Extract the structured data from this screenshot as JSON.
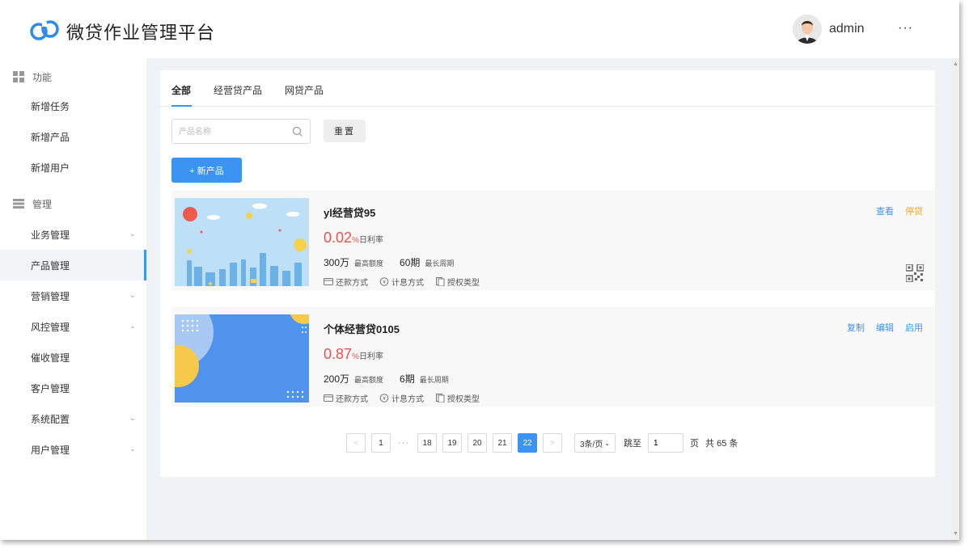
{
  "header": {
    "app_title": "微贷作业管理平台",
    "username": "admin",
    "more": "···"
  },
  "sidebar": {
    "groups": [
      {
        "label": "功能",
        "icon": "grid-icon"
      },
      {
        "label": "管理",
        "icon": "stack-icon"
      }
    ],
    "function_items": [
      "新增任务",
      "新增产品",
      "新增用户"
    ],
    "management_items": [
      {
        "label": "业务管理",
        "expandable": true
      },
      {
        "label": "产品管理",
        "expandable": false,
        "active": true
      },
      {
        "label": "营销管理",
        "expandable": true
      },
      {
        "label": "风控管理",
        "expandable": true
      },
      {
        "label": "催收管理",
        "expandable": false
      },
      {
        "label": "客户管理",
        "expandable": false
      },
      {
        "label": "系统配置",
        "expandable": true
      },
      {
        "label": "用户管理",
        "expandable": true
      }
    ]
  },
  "tabs": [
    {
      "label": "全部",
      "active": true
    },
    {
      "label": "经营贷产品",
      "active": false
    },
    {
      "label": "网贷产品",
      "active": false
    }
  ],
  "filters": {
    "search_placeholder": "产品名称",
    "search_value": "",
    "reset_label": "重置",
    "new_product_label": "+ 新产品"
  },
  "products": [
    {
      "name": "yl经营贷95",
      "rate": "0.02",
      "rate_unit": "%",
      "rate_label": "日利率",
      "amount": "300万",
      "amount_label": "最高额度",
      "period": "60期",
      "period_label": "最长周期",
      "tags": [
        "还款方式",
        "计息方式",
        "授权类型"
      ],
      "actions": [
        {
          "label": "查看",
          "style": "link"
        },
        {
          "label": "停贷",
          "style": "warn"
        }
      ],
      "has_qr": true,
      "thumb": "city-skyline"
    },
    {
      "name": "个体经营贷0105",
      "rate": "0.87",
      "rate_unit": "%",
      "rate_label": "日利率",
      "amount": "200万",
      "amount_label": "最高额度",
      "period": "6期",
      "period_label": "最长周期",
      "tags": [
        "还款方式",
        "计息方式",
        "授权类型"
      ],
      "actions": [
        {
          "label": "复制",
          "style": "link"
        },
        {
          "label": "编辑",
          "style": "link"
        },
        {
          "label": "启用",
          "style": "link"
        }
      ],
      "has_qr": false,
      "thumb": "blue-circles"
    }
  ],
  "pagination": {
    "prev": "<",
    "next": ">",
    "pages": [
      "1",
      "···",
      "18",
      "19",
      "20",
      "21",
      "22"
    ],
    "current": "22",
    "page_size": "3条/页",
    "jump_label": "跳至",
    "jump_value": "1",
    "page_unit": "页",
    "total": "共 65 条"
  },
  "colors": {
    "primary": "#3b94f2",
    "rate_red": "#f0504f",
    "warn_orange": "#f5a623",
    "page_bg": "#f0f2f5"
  }
}
